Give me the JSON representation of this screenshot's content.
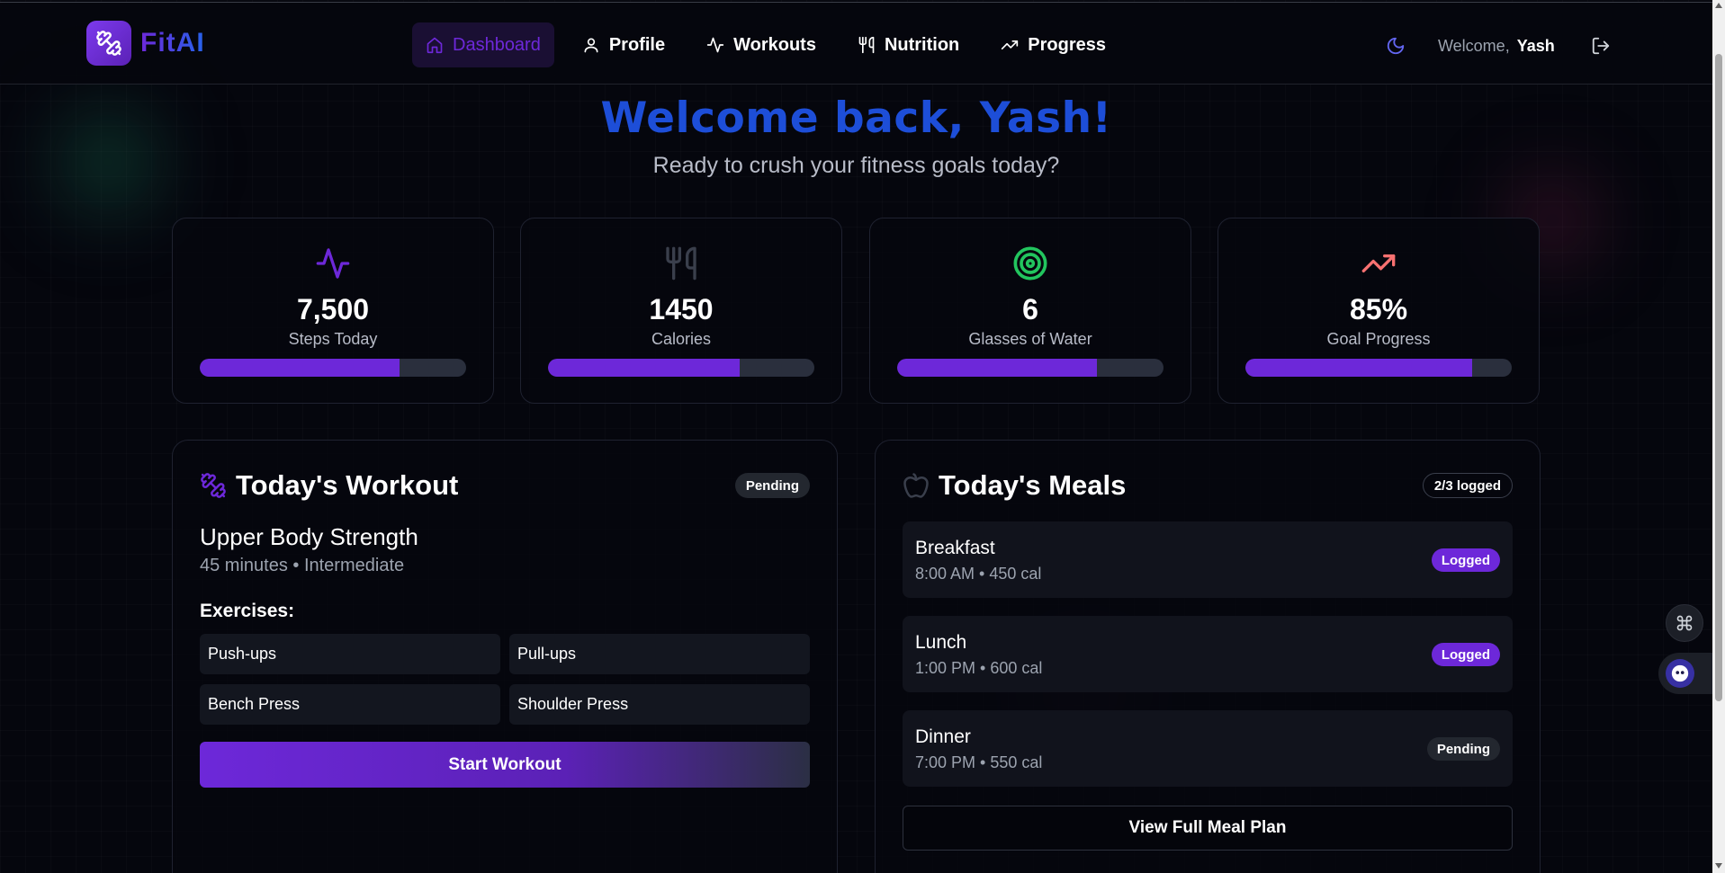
{
  "brand": {
    "name": "FitAI"
  },
  "nav": {
    "items": [
      {
        "label": "Dashboard",
        "icon": "home-icon",
        "active": true
      },
      {
        "label": "Profile",
        "icon": "user-icon",
        "active": false
      },
      {
        "label": "Workouts",
        "icon": "activity-icon",
        "active": false
      },
      {
        "label": "Nutrition",
        "icon": "utensils-icon",
        "active": false
      },
      {
        "label": "Progress",
        "icon": "trending-up-icon",
        "active": false
      }
    ]
  },
  "user": {
    "welcome_prefix": "Welcome,",
    "name": "Yash"
  },
  "hero": {
    "title": "Welcome back, Yash!",
    "subtitle": "Ready to crush your fitness goals today?"
  },
  "stats": [
    {
      "value": "7,500",
      "label": "Steps Today",
      "icon": "activity-icon",
      "icon_color": "#6d28d9",
      "progress": 0.75
    },
    {
      "value": "1450",
      "label": "Calories",
      "icon": "utensils-icon",
      "icon_color": "#3a3f4c",
      "progress": 0.72
    },
    {
      "value": "6",
      "label": "Glasses of Water",
      "icon": "target-icon",
      "icon_color": "#22c55e",
      "progress": 0.75
    },
    {
      "value": "85%",
      "label": "Goal Progress",
      "icon": "trending-up-icon",
      "icon_color": "#f87171",
      "progress": 0.85
    }
  ],
  "workout": {
    "title": "Today's Workout",
    "status": "Pending",
    "name": "Upper Body Strength",
    "meta": "45 minutes • Intermediate",
    "exercises_label": "Exercises:",
    "exercises": [
      "Push-ups",
      "Pull-ups",
      "Bench Press",
      "Shoulder Press"
    ],
    "start_label": "Start Workout"
  },
  "meals": {
    "title": "Today's Meals",
    "count_badge": "2/3 logged",
    "items": [
      {
        "name": "Breakfast",
        "meta": "8:00 AM • 450 cal",
        "status": "Logged"
      },
      {
        "name": "Lunch",
        "meta": "1:00 PM • 600 cal",
        "status": "Logged"
      },
      {
        "name": "Dinner",
        "meta": "7:00 PM • 550 cal",
        "status": "Pending"
      }
    ],
    "view_all_label": "View Full Meal Plan"
  },
  "colors": {
    "accent": "#6d28d9",
    "title_blue": "#1d4ed8",
    "background": "#05060d"
  }
}
